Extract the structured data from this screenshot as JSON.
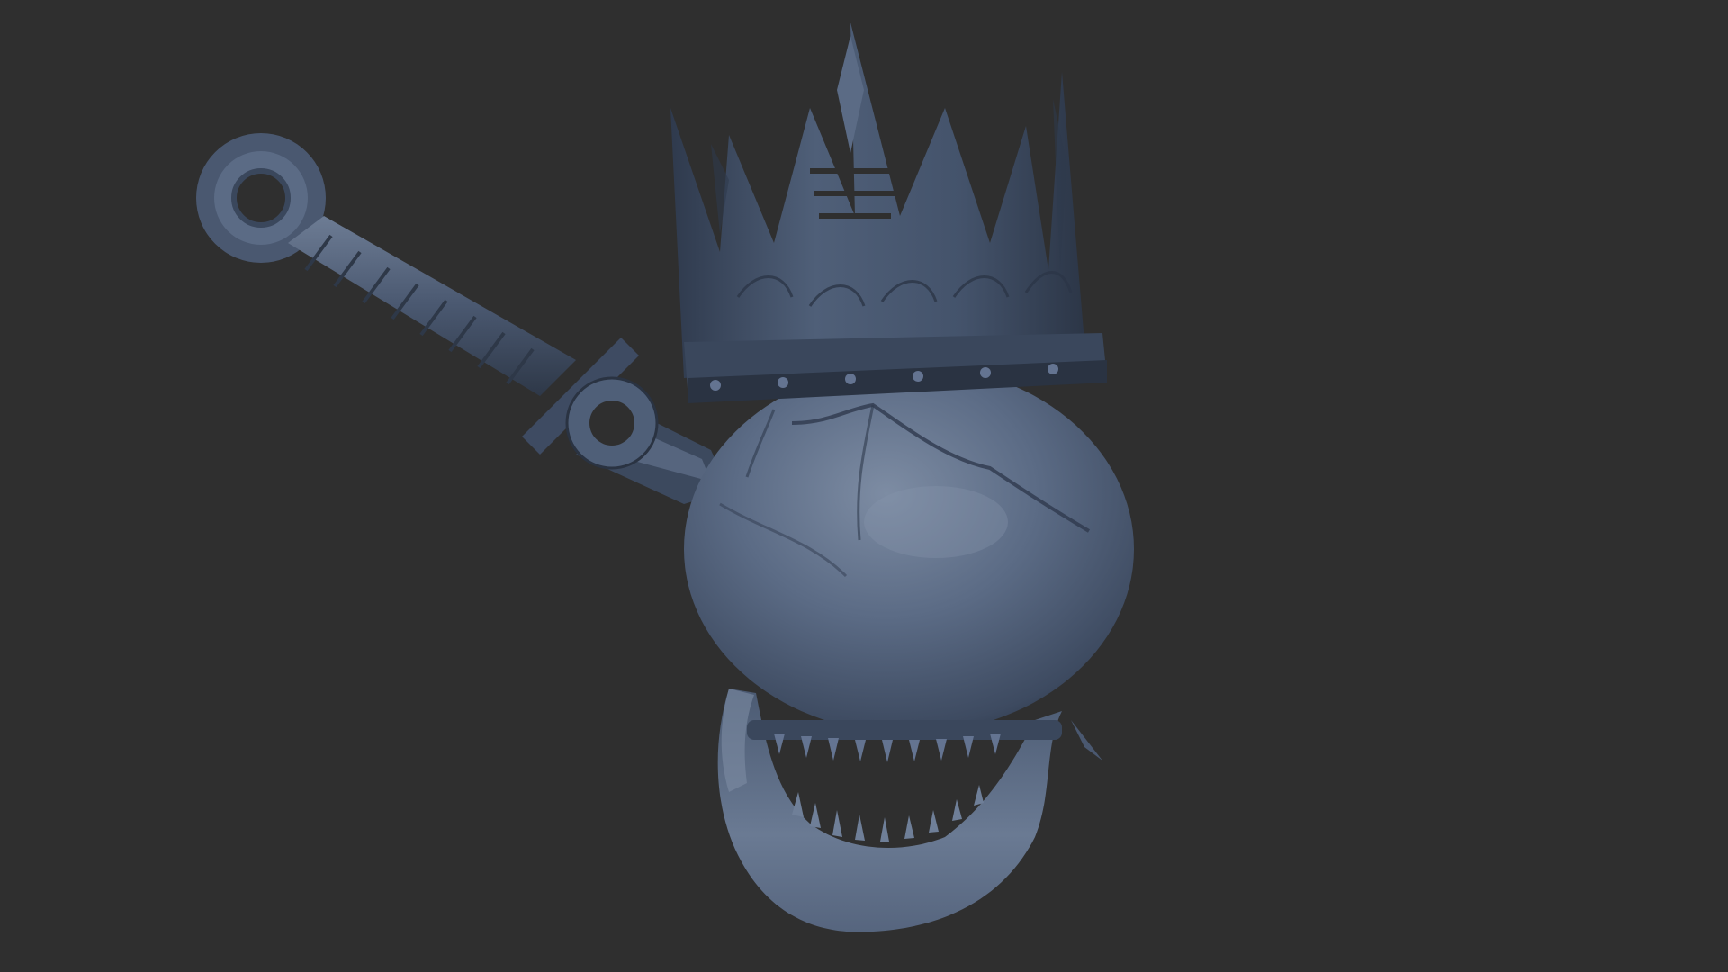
{
  "viewport": {
    "background": "#2f2f2f",
    "model_base_color": "#4f5f78",
    "model_shadow_color": "#2a3342",
    "model_highlight_color": "#7d8ca3"
  },
  "model": {
    "parts": [
      "crown",
      "skull-cranium",
      "lower-jaw",
      "dagger"
    ],
    "icons": {
      "crown": "crown-icon",
      "dagger": "dagger-icon",
      "skull": "skull-icon"
    }
  }
}
